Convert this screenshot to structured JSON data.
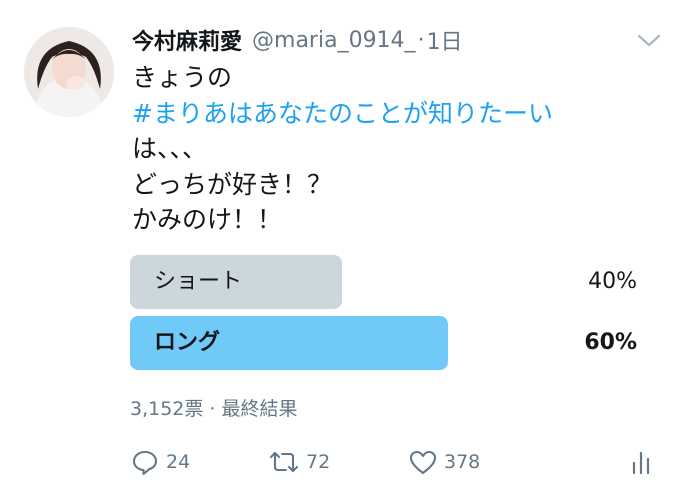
{
  "tweet": {
    "display_name": "今村麻莉愛",
    "handle": "@maria_0914_",
    "separator": "·",
    "time": "1日",
    "lines": [
      "きょうの",
      "#まりあはあなたのことが知りたーい",
      "は、、、",
      "どっちが好き！？",
      "かみのけ！！"
    ]
  },
  "poll": {
    "options": [
      {
        "label": "ショート",
        "percent_text": "40%",
        "share": 0.4,
        "winner": false
      },
      {
        "label": "ロング",
        "percent_text": "60%",
        "share": 0.6,
        "winner": true
      }
    ],
    "meta": "3,152票 · 最終結果"
  },
  "actions": {
    "reply_count": "24",
    "retweet_count": "72",
    "like_count": "378"
  },
  "colors": {
    "hashtag": "#1da1f2",
    "poll_loser": "#ccd6dd",
    "poll_winner": "#71c9f8",
    "muted": "#657786"
  },
  "icons": [
    "avatar",
    "chevron-down-icon",
    "reply-icon",
    "retweet-icon",
    "like-icon",
    "analytics-icon"
  ]
}
